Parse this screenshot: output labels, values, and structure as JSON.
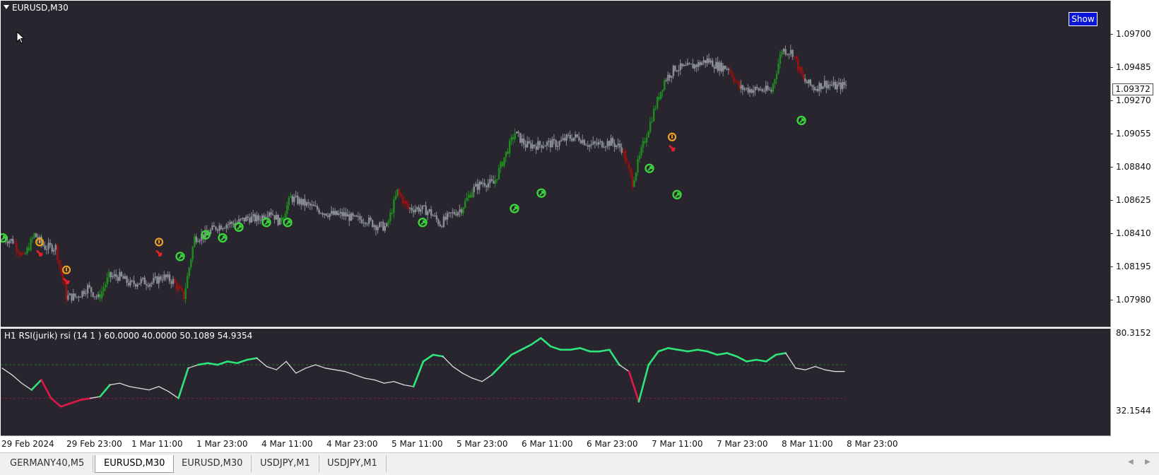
{
  "window": {
    "symbol_label": "EURUSD,M30"
  },
  "show_button": {
    "label": "Show"
  },
  "price_axis": {
    "labels": [
      "1.09700",
      "1.09485",
      "1.09270",
      "1.09055",
      "1.08840",
      "1.08625",
      "1.08410",
      "1.08195",
      "1.07980"
    ],
    "current_price": "1.09372"
  },
  "indicator": {
    "title": "H1 RSI(jurik) rsi (14 1 ) 60.0000 40.0000 50.1089 54.9354",
    "scale_max": "80.3152",
    "scale_min": "32.1544"
  },
  "time_axis": [
    "29 Feb 2024",
    "29 Feb 23:00",
    "1 Mar 11:00",
    "1 Mar 23:00",
    "4 Mar 11:00",
    "4 Mar 23:00",
    "5 Mar 11:00",
    "5 Mar 23:00",
    "6 Mar 11:00",
    "6 Mar 23:00",
    "7 Mar 11:00",
    "7 Mar 23:00",
    "8 Mar 11:00",
    "8 Mar 23:00"
  ],
  "tabs": [
    "GERMANY40,M5",
    "EURUSD,M30",
    "EURUSD,M30",
    "USDJPY,M1",
    "USDJPY,M1"
  ],
  "active_tab": 1,
  "colors": {
    "background": "#28252e",
    "bull": "#1f8c1f",
    "bear": "#9b1010",
    "neutral": "#8a8f96",
    "rsi_up": "#2ee57a",
    "rsi_down": "#e0184a",
    "rsi_neutral": "#dcdcdc",
    "arrow_green": "#3bd43b",
    "arrow_red": "#e8202a",
    "warning": "#f0a020",
    "show_button": "#0c16d6"
  },
  "chart_data": {
    "type": "candlestick",
    "price_series": [
      {
        "time": "29 Feb 2024",
        "price": 1.0838
      },
      {
        "time": "29 Feb 2024",
        "price": 1.0836
      },
      {
        "time": "29 Feb 2024",
        "price": 1.0825
      },
      {
        "time": "29 Feb 2024",
        "price": 1.084
      },
      {
        "time": "29 Feb 2024",
        "price": 1.0832
      },
      {
        "time": "29 Feb 2024",
        "price": 1.0832
      },
      {
        "time": "29 Feb 2024",
        "price": 1.08
      },
      {
        "time": "29 Feb 2024",
        "price": 1.08
      },
      {
        "time": "29 Feb 2024",
        "price": 1.0806
      },
      {
        "time": "29 Feb 23:00",
        "price": 1.0799
      },
      {
        "time": "29 Feb 23:00",
        "price": 1.0813
      },
      {
        "time": "29 Feb 23:00",
        "price": 1.0813
      },
      {
        "time": "29 Feb 23:00",
        "price": 1.0808
      },
      {
        "time": "29 Feb 23:00",
        "price": 1.081
      },
      {
        "time": "1 Mar 11:00",
        "price": 1.0809
      },
      {
        "time": "1 Mar 11:00",
        "price": 1.0813
      },
      {
        "time": "1 Mar 11:00",
        "price": 1.081
      },
      {
        "time": "1 Mar 11:00",
        "price": 1.08
      },
      {
        "time": "1 Mar 11:00",
        "price": 1.0838
      },
      {
        "time": "1 Mar 23:00",
        "price": 1.084
      },
      {
        "time": "1 Mar 23:00",
        "price": 1.0845
      },
      {
        "time": "1 Mar 23:00",
        "price": 1.0847
      },
      {
        "time": "1 Mar 23:00",
        "price": 1.0848
      },
      {
        "time": "1 Mar 23:00",
        "price": 1.0851
      },
      {
        "time": "4 Mar 11:00",
        "price": 1.085
      },
      {
        "time": "4 Mar 11:00",
        "price": 1.0856
      },
      {
        "time": "4 Mar 11:00",
        "price": 1.0848
      },
      {
        "time": "4 Mar 11:00",
        "price": 1.0864
      },
      {
        "time": "4 Mar 11:00",
        "price": 1.0861
      },
      {
        "time": "4 Mar 11:00",
        "price": 1.0858
      },
      {
        "time": "4 Mar 23:00",
        "price": 1.0855
      },
      {
        "time": "4 Mar 23:00",
        "price": 1.0853
      },
      {
        "time": "4 Mar 23:00",
        "price": 1.0853
      },
      {
        "time": "4 Mar 23:00",
        "price": 1.085
      },
      {
        "time": "5 Mar 11:00",
        "price": 1.085
      },
      {
        "time": "5 Mar 11:00",
        "price": 1.0846
      },
      {
        "time": "5 Mar 11:00",
        "price": 1.0845
      },
      {
        "time": "5 Mar 11:00",
        "price": 1.0868
      },
      {
        "time": "5 Mar 11:00",
        "price": 1.0857
      },
      {
        "time": "5 Mar 11:00",
        "price": 1.0857
      },
      {
        "time": "5 Mar 23:00",
        "price": 1.0855
      },
      {
        "time": "5 Mar 23:00",
        "price": 1.0847
      },
      {
        "time": "5 Mar 23:00",
        "price": 1.0853
      },
      {
        "time": "5 Mar 23:00",
        "price": 1.0857
      },
      {
        "time": "5 Mar 23:00",
        "price": 1.0869
      },
      {
        "time": "6 Mar 11:00",
        "price": 1.0874
      },
      {
        "time": "6 Mar 11:00",
        "price": 1.0873
      },
      {
        "time": "6 Mar 11:00",
        "price": 1.089
      },
      {
        "time": "6 Mar 11:00",
        "price": 1.0906
      },
      {
        "time": "6 Mar 11:00",
        "price": 1.0898
      },
      {
        "time": "6 Mar 11:00",
        "price": 1.0898
      },
      {
        "time": "6 Mar 23:00",
        "price": 1.0899
      },
      {
        "time": "6 Mar 23:00",
        "price": 1.0899
      },
      {
        "time": "6 Mar 23:00",
        "price": 1.0903
      },
      {
        "time": "6 Mar 23:00",
        "price": 1.0903
      },
      {
        "time": "6 Mar 23:00",
        "price": 1.0898
      },
      {
        "time": "7 Mar 11:00",
        "price": 1.0899
      },
      {
        "time": "7 Mar 11:00",
        "price": 1.09
      },
      {
        "time": "7 Mar 11:00",
        "price": 1.0896
      },
      {
        "time": "7 Mar 11:00",
        "price": 1.0874
      },
      {
        "time": "7 Mar 11:00",
        "price": 1.0898
      },
      {
        "time": "7 Mar 11:00",
        "price": 1.092
      },
      {
        "time": "7 Mar 23:00",
        "price": 1.094
      },
      {
        "time": "7 Mar 23:00",
        "price": 1.0948
      },
      {
        "time": "7 Mar 23:00",
        "price": 1.0948
      },
      {
        "time": "7 Mar 23:00",
        "price": 1.095
      },
      {
        "time": "7 Mar 23:00",
        "price": 1.0953
      },
      {
        "time": "7 Mar 23:00",
        "price": 1.0949
      },
      {
        "time": "8 Mar 11:00",
        "price": 1.0948
      },
      {
        "time": "8 Mar 11:00",
        "price": 1.0935
      },
      {
        "time": "8 Mar 11:00",
        "price": 1.0934
      },
      {
        "time": "8 Mar 11:00",
        "price": 1.0934
      },
      {
        "time": "8 Mar 11:00",
        "price": 1.0933
      },
      {
        "time": "8 Mar 11:00",
        "price": 1.096
      },
      {
        "time": "8 Mar 11:00",
        "price": 1.0958
      },
      {
        "time": "8 Mar 11:00",
        "price": 1.094
      },
      {
        "time": "8 Mar 11:00",
        "price": 1.0935
      },
      {
        "time": "8 Mar 23:00",
        "price": 1.0938
      },
      {
        "time": "8 Mar 23:00",
        "price": 1.0936
      },
      {
        "time": "8 Mar 23:00",
        "price": 1.0937
      }
    ],
    "ylim": [
      1.079,
      1.098
    ],
    "rsi_series": [
      58,
      54,
      49,
      45,
      51,
      40,
      35,
      37,
      39,
      40,
      41,
      48,
      49,
      47,
      46,
      45,
      47,
      44,
      40,
      58,
      60,
      61,
      60,
      62,
      61,
      63,
      64,
      59,
      57,
      62,
      55,
      58,
      60,
      58,
      57,
      56,
      54,
      52,
      51,
      49,
      50,
      48,
      47,
      62,
      66,
      65,
      59,
      55,
      52,
      50,
      54,
      60,
      66,
      69,
      72,
      76,
      71,
      69,
      69,
      70,
      68,
      68,
      69,
      60,
      56,
      38,
      60,
      68,
      70,
      69,
      68,
      69,
      68,
      66,
      67,
      65,
      62,
      63,
      62,
      66,
      67,
      58,
      57,
      59,
      57,
      56,
      56
    ],
    "rsi_levels": [
      60,
      40
    ],
    "rsi_ylim": [
      32.1544,
      80.3152
    ],
    "signals": [
      {
        "time": "29 Feb 2024",
        "kind": "buy"
      },
      {
        "time": "29 Feb 2024",
        "kind": "sell"
      },
      {
        "time": "29 Feb 23:00",
        "kind": "sell"
      },
      {
        "time": "1 Mar 11:00",
        "kind": "sell"
      },
      {
        "time": "1 Mar 11:00",
        "kind": "buy"
      },
      {
        "time": "1 Mar 23:00",
        "kind": "buy"
      },
      {
        "time": "1 Mar 23:00",
        "kind": "buy"
      },
      {
        "time": "1 Mar 23:00",
        "kind": "buy"
      },
      {
        "time": "4 Mar 11:00",
        "kind": "buy"
      },
      {
        "time": "4 Mar 11:00",
        "kind": "buy"
      },
      {
        "time": "5 Mar 11:00",
        "kind": "buy"
      },
      {
        "time": "5 Mar 23:00",
        "kind": "buy"
      },
      {
        "time": "6 Mar 11:00",
        "kind": "buy"
      },
      {
        "time": "7 Mar 11:00",
        "kind": "buy"
      },
      {
        "time": "7 Mar 11:00",
        "kind": "sell"
      },
      {
        "time": "7 Mar 11:00",
        "kind": "buy"
      },
      {
        "time": "8 Mar 11:00",
        "kind": "buy"
      }
    ]
  }
}
